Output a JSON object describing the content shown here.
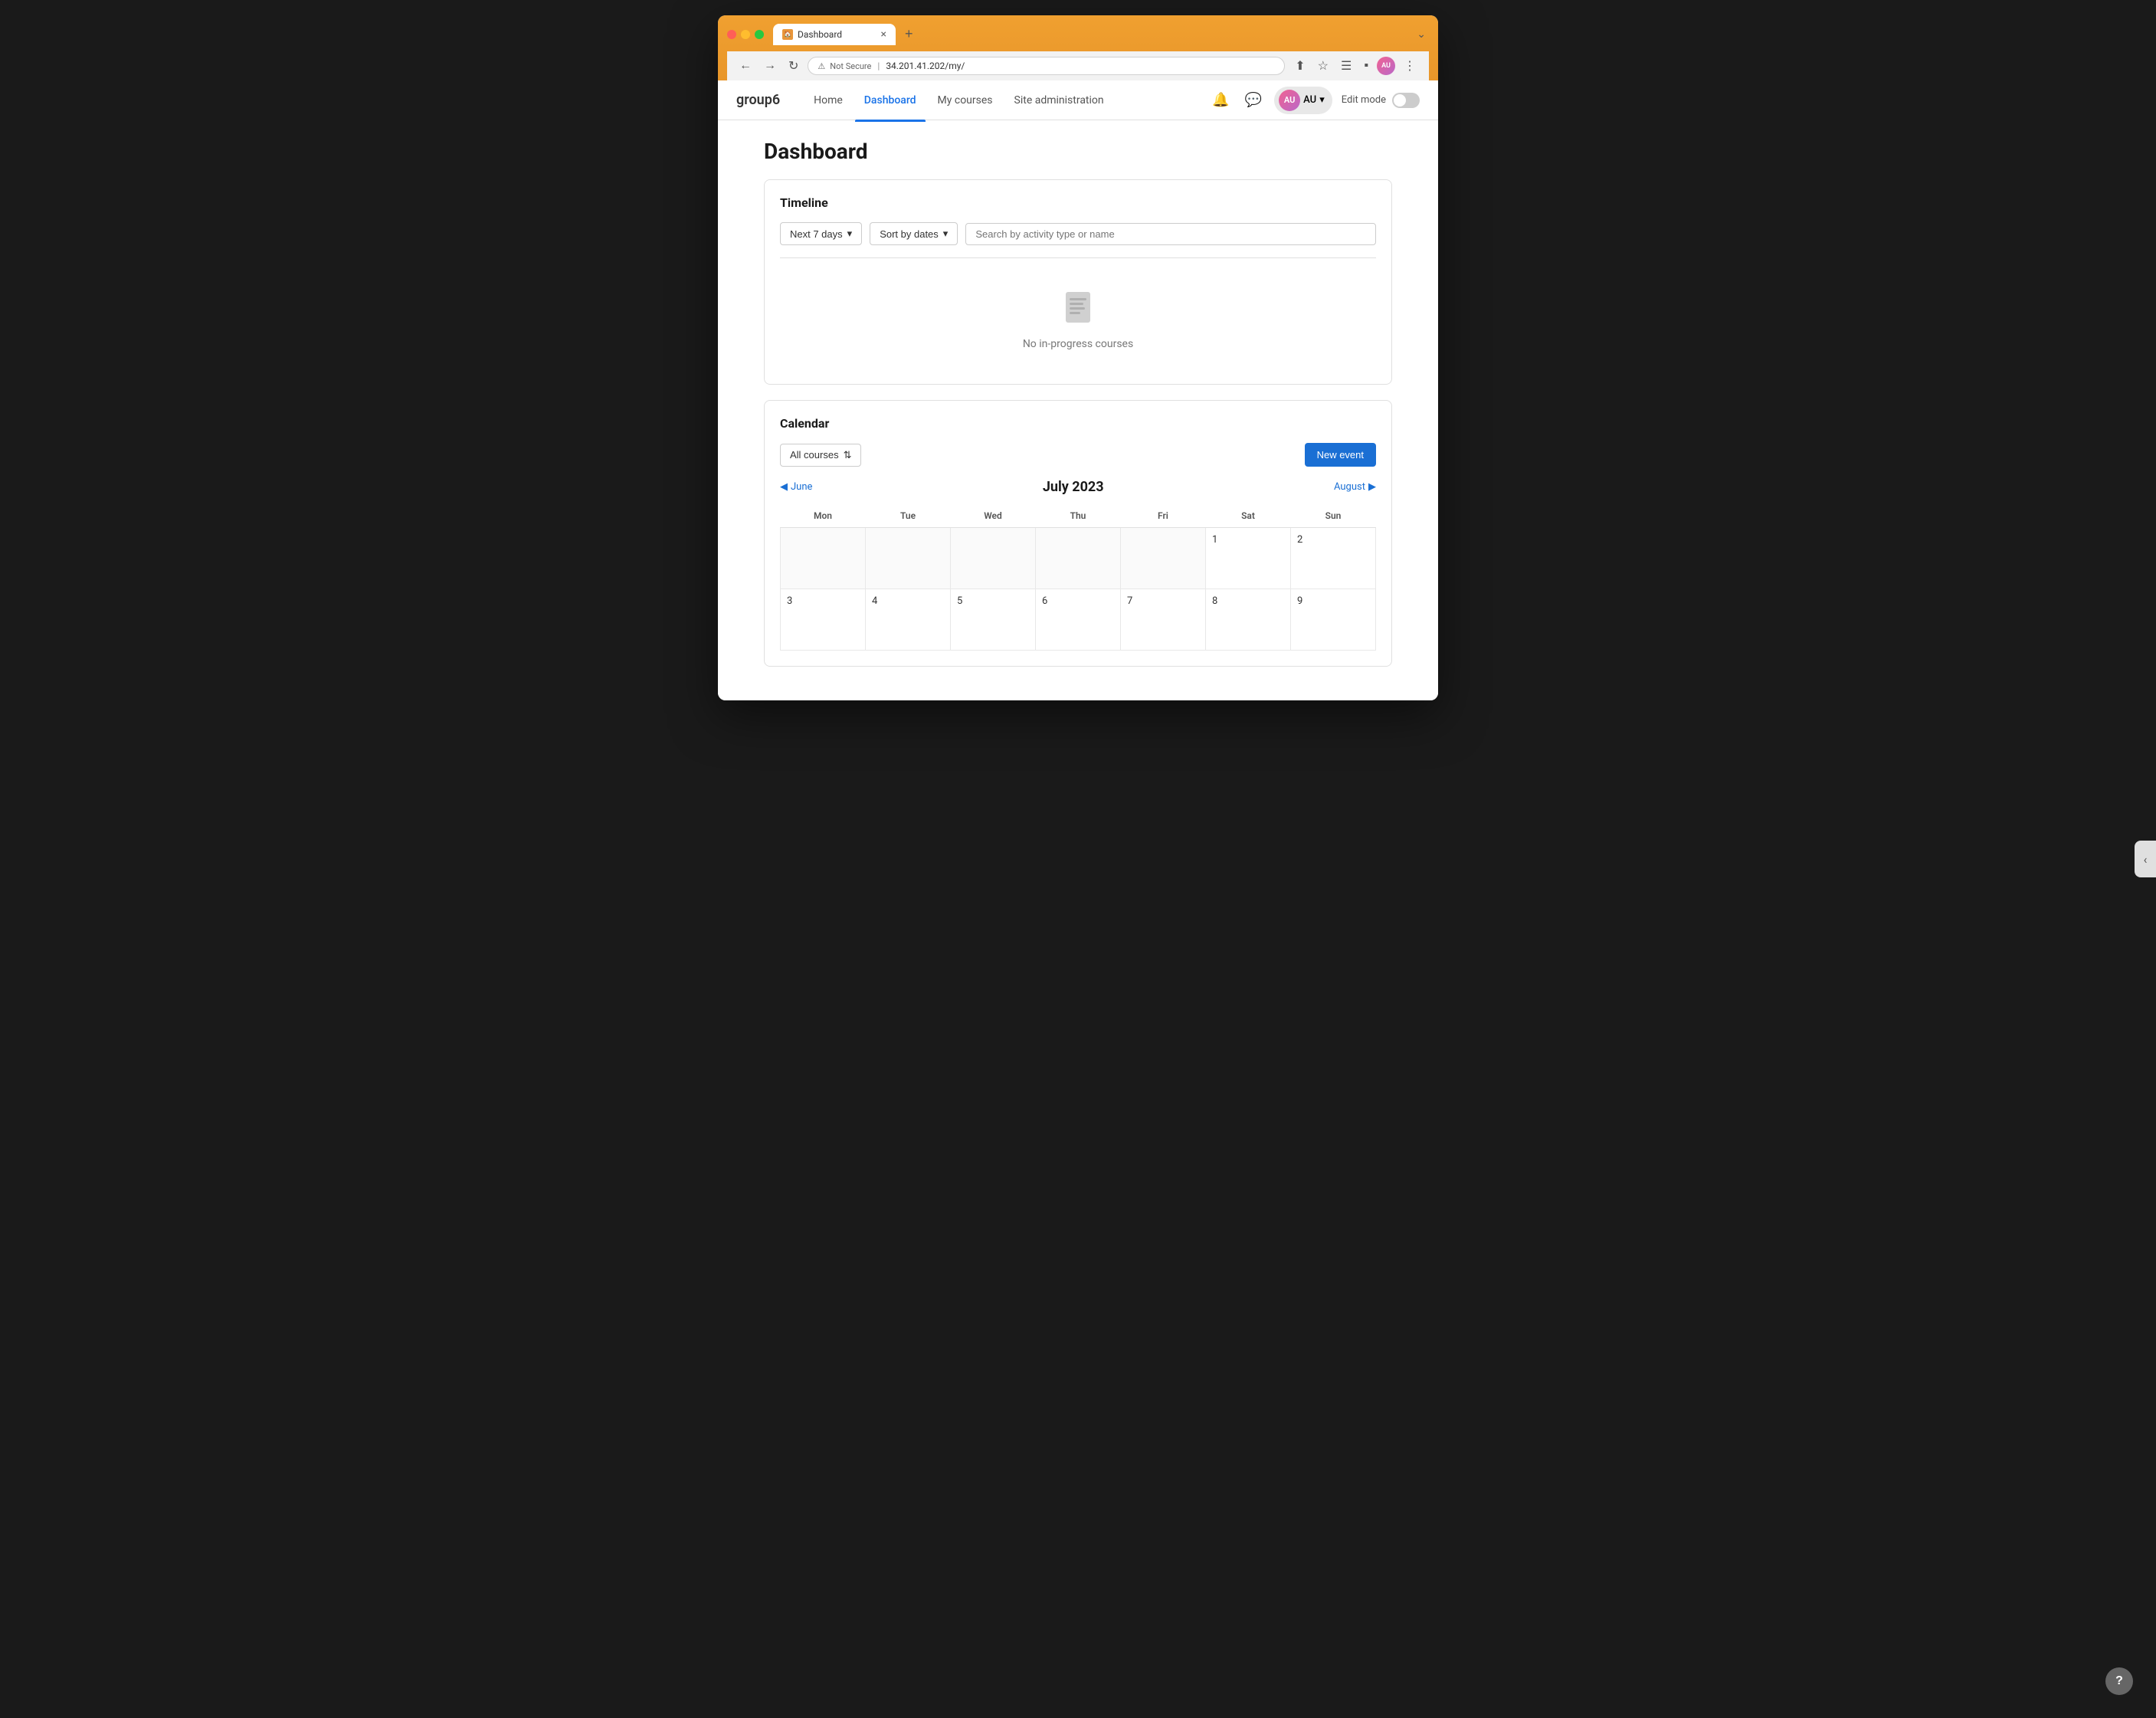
{
  "browser": {
    "tab_title": "Dashboard",
    "tab_favicon": "🏠",
    "new_tab_label": "+",
    "address": "34.201.41.202/my/",
    "not_secure_label": "Not Secure",
    "close_label": "×"
  },
  "nav": {
    "brand": "group6",
    "links": [
      {
        "label": "Home",
        "active": false
      },
      {
        "label": "Dashboard",
        "active": true
      },
      {
        "label": "My courses",
        "active": false
      },
      {
        "label": "Site administration",
        "active": false
      }
    ],
    "user_initials": "AU",
    "edit_mode_label": "Edit mode",
    "notifications_label": "🔔",
    "messages_label": "💬"
  },
  "page": {
    "title": "Dashboard"
  },
  "timeline": {
    "card_title": "Timeline",
    "next_days_label": "Next 7 days",
    "sort_label": "Sort by dates",
    "search_placeholder": "Search by activity type or name",
    "empty_text": "No in-progress courses"
  },
  "calendar": {
    "card_title": "Calendar",
    "all_courses_label": "All courses",
    "new_event_label": "New event",
    "month_label": "July 2023",
    "prev_month": "June",
    "next_month": "August",
    "day_headers": [
      "Mon",
      "Tue",
      "Wed",
      "Thu",
      "Fri",
      "Sat",
      "Sun"
    ],
    "weeks": [
      [
        {
          "date": "",
          "empty": true
        },
        {
          "date": "",
          "empty": true
        },
        {
          "date": "",
          "empty": true
        },
        {
          "date": "",
          "empty": true
        },
        {
          "date": "",
          "empty": true
        },
        {
          "date": "1",
          "empty": false
        },
        {
          "date": "2",
          "empty": false
        }
      ],
      [
        {
          "date": "3",
          "empty": false
        },
        {
          "date": "4",
          "empty": false
        },
        {
          "date": "5",
          "empty": false
        },
        {
          "date": "6",
          "empty": false
        },
        {
          "date": "7",
          "empty": false
        },
        {
          "date": "8",
          "empty": false
        },
        {
          "date": "9",
          "empty": false
        }
      ]
    ]
  },
  "sidebar_toggle": "‹",
  "help_label": "?"
}
